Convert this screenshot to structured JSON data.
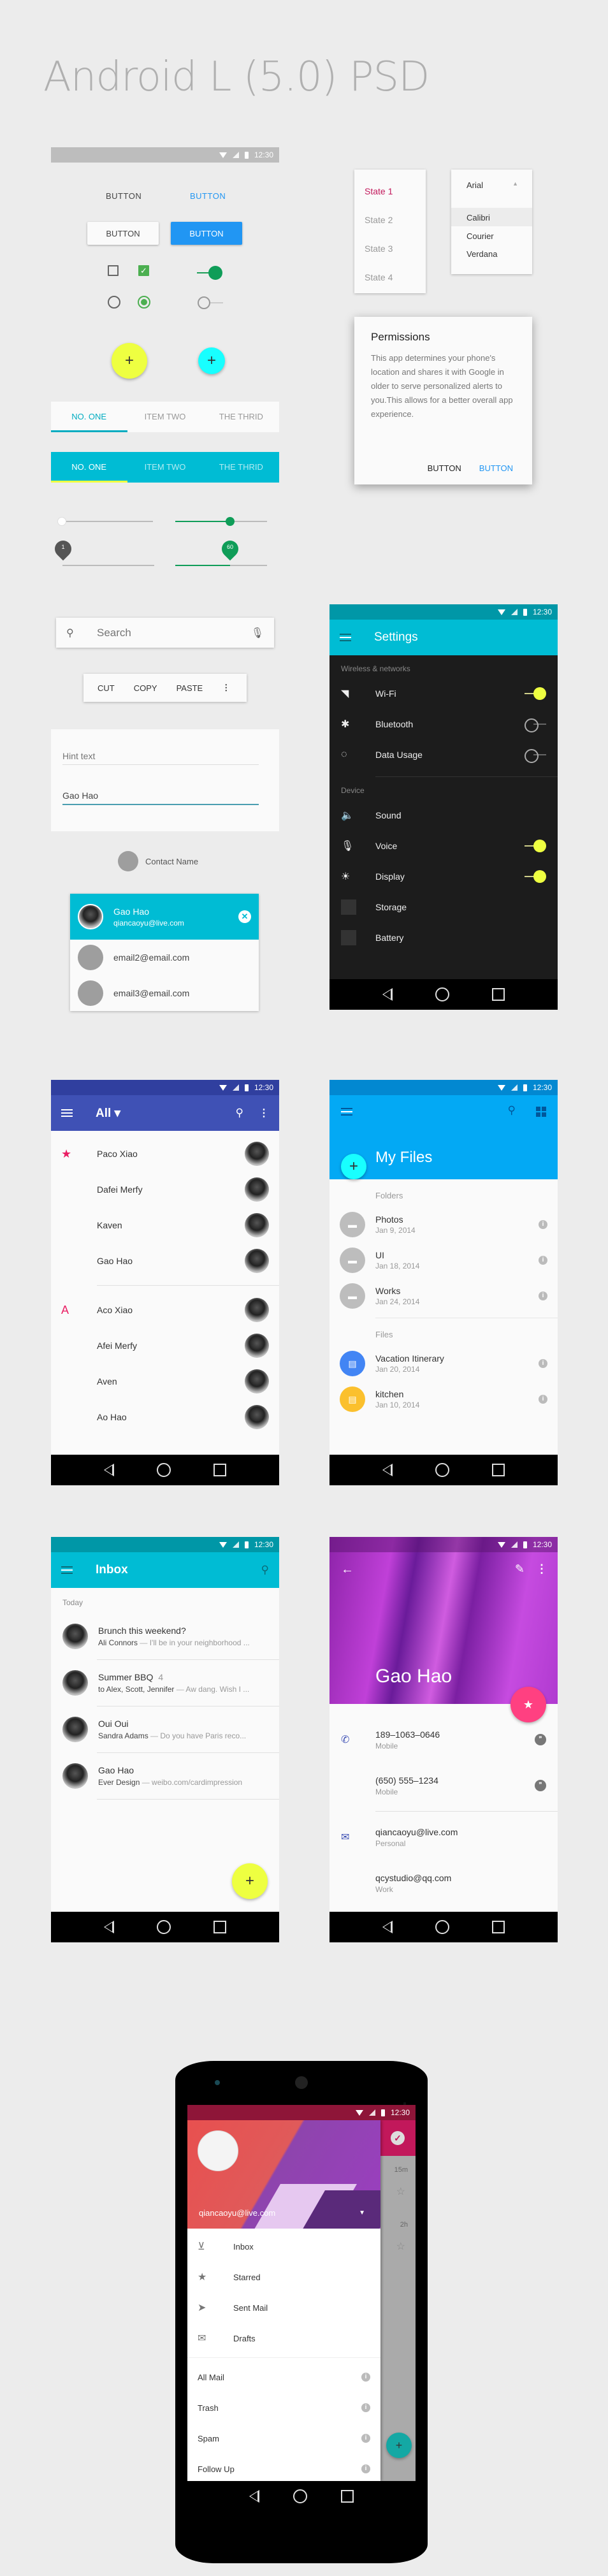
{
  "page_title": "Android L (5.0) PSD",
  "status_time": "12:30",
  "colors": {
    "cyan": "#00bcd4",
    "blue": "#2196f3",
    "green": "#4caf50",
    "indigo": "#3f51b5",
    "pink": "#ff4081",
    "lime": "#eeff41"
  },
  "widgets": {
    "flat_button": "BUTTON",
    "flat_button_colored": "BUTTON",
    "raised_button": "BUTTON",
    "raised_button_colored": "BUTTON",
    "checkbox_unchecked": false,
    "checkbox_checked": true,
    "switch_on": true,
    "switch_off": false,
    "fab_large_icon": "+",
    "fab_small_icon": "+"
  },
  "state_menu": {
    "items": [
      "State 1",
      "State 2",
      "State 3",
      "State 4"
    ],
    "selected": 0
  },
  "font_dropdown": {
    "selected": "Arial",
    "options": [
      "Calibri",
      "Courier",
      "Verdana"
    ],
    "highlighted": 0
  },
  "dialog": {
    "title": "Permissions",
    "body": "This app determines your phone's location and shares it with Google in older to serve personalized alerts to you.This allows for a better overall app experience.",
    "button_1": "BUTTON",
    "button_2": "BUTTON"
  },
  "tabs_light": {
    "items": [
      "NO. ONE",
      "ITEM TWO",
      "THE THRID"
    ],
    "active": 0
  },
  "tabs_dark": {
    "items": [
      "NO. ONE",
      "ITEM TWO",
      "THE THRID"
    ],
    "active": 0
  },
  "sliders": {
    "slider_1": 0,
    "slider_2": 0.6,
    "discrete_1_label": "1",
    "discrete_1": 0,
    "discrete_2_label": "60",
    "discrete_2": 0.6
  },
  "search": {
    "placeholder": "Search"
  },
  "text_menu": {
    "items": [
      "CUT",
      "COPY",
      "PASTE"
    ]
  },
  "text_fields": {
    "hint": "Hint text",
    "value": "Gao Hao"
  },
  "contact_chip": {
    "label": "Contact Name"
  },
  "contact_picker": {
    "selected": {
      "name": "Gao Hao",
      "email": "qiancaoyu@live.com"
    },
    "others": [
      "email2@email.com",
      "email3@email.com"
    ]
  },
  "settings": {
    "title": "Settings",
    "section_1": "Wireless & networks",
    "section_2": "Device",
    "items": [
      {
        "label": "Wi-Fi",
        "icon": "wifi-icon",
        "toggle": "on"
      },
      {
        "label": "Bluetooth",
        "icon": "bluetooth-icon",
        "toggle": "off"
      },
      {
        "label": "Data Usage",
        "icon": "data-usage-icon",
        "toggle": "off"
      },
      {
        "label": "Sound",
        "icon": "sound-icon",
        "toggle": "none"
      },
      {
        "label": "Voice",
        "icon": "mic-icon",
        "toggle": "on"
      },
      {
        "label": "Display",
        "icon": "brightness-icon",
        "toggle": "on"
      },
      {
        "label": "Storage",
        "icon": "storage-icon",
        "toggle": "none"
      },
      {
        "label": "Battery",
        "icon": "battery-icon",
        "toggle": "none"
      }
    ]
  },
  "contacts": {
    "title": "All",
    "groups": [
      {
        "marker": "★",
        "names": [
          "Paco Xiao",
          "Dafei Merfy",
          "Kaven",
          "Gao Hao"
        ]
      },
      {
        "marker": "A",
        "names": [
          "Aco Xiao",
          "Afei Merfy",
          "Aven",
          "Ao Hao"
        ]
      }
    ]
  },
  "files": {
    "title": "My Files",
    "folders_header": "Folders",
    "files_header": "Files",
    "folders": [
      {
        "name": "Photos",
        "date": "Jan 9, 2014"
      },
      {
        "name": "UI",
        "date": "Jan 18, 2014"
      },
      {
        "name": "Works",
        "date": "Jan 24, 2014"
      }
    ],
    "files": [
      {
        "name": "Vacation Itinerary",
        "date": "Jan 20, 2014",
        "color": "#4285f4"
      },
      {
        "name": "kitchen",
        "date": "Jan 10, 2014",
        "color": "#fbc02d"
      }
    ]
  },
  "inbox": {
    "title": "Inbox",
    "section": "Today",
    "messages": [
      {
        "subject": "Brunch this weekend?",
        "count": "",
        "sender": "Ali Connors",
        "preview": "I'll be in your neighborhood ..."
      },
      {
        "subject": "Summer BBQ",
        "count": "4",
        "sender": "to Alex, Scott, Jennifer",
        "preview": "Aw dang. Wish I ..."
      },
      {
        "subject": "Oui Oui",
        "count": "",
        "sender": "Sandra Adams",
        "preview": "Do you have Paris reco..."
      },
      {
        "subject": "Gao Hao",
        "count": "",
        "sender": "Ever Design",
        "preview": "weibo.com/cardimpression"
      }
    ]
  },
  "contact_detail": {
    "name": "Gao Hao",
    "phones": [
      {
        "value": "189–1063–0646",
        "type": "Mobile"
      },
      {
        "value": "(650) 555–1234",
        "type": "Mobile"
      }
    ],
    "emails": [
      {
        "value": "qiancaoyu@live.com",
        "type": "Personal"
      },
      {
        "value": "qcystudio@qq.com",
        "type": "Work"
      }
    ]
  },
  "drawer": {
    "account": "qiancaoyu@live.com",
    "primary": [
      {
        "label": "Inbox",
        "icon": "inbox-icon"
      },
      {
        "label": "Starred",
        "icon": "star-icon"
      },
      {
        "label": "Sent Mail",
        "icon": "send-icon"
      },
      {
        "label": "Drafts",
        "icon": "drafts-icon"
      }
    ],
    "secondary": [
      "All Mail",
      "Trash",
      "Spam",
      "Follow Up"
    ],
    "behind_times": [
      "15m",
      "2h"
    ]
  }
}
